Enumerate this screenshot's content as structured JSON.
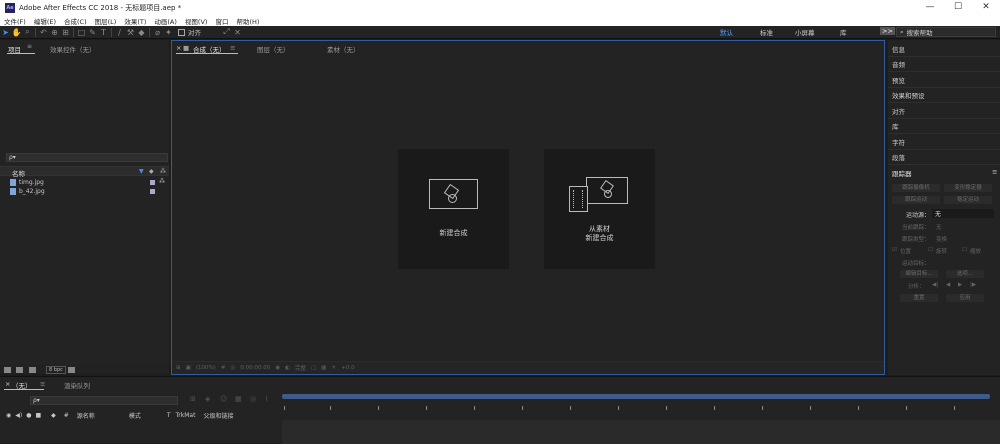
{
  "window": {
    "title": "Adobe After Effects CC 2018 - 无标题项目.aep *",
    "app_badge": "Ae",
    "minimize": "—",
    "maximize": "☐",
    "close": "✕"
  },
  "menu": [
    "文件(F)",
    "编辑(E)",
    "合成(C)",
    "图层(L)",
    "效果(T)",
    "动画(A)",
    "视图(V)",
    "窗口",
    "帮助(H)"
  ],
  "toolbar": {
    "align_label": "对齐",
    "workspaces": [
      "默认",
      "标准",
      "小屏幕",
      "库"
    ],
    "active_workspace": "默认",
    "overflow": ">>",
    "search_placeholder": "搜索帮助"
  },
  "project": {
    "tab_project": "项目",
    "tab_effects": "效果控件（无）",
    "search_placeholder": "ρ▾",
    "col_name": "名称",
    "files": [
      "timg.jpg",
      "b_42.jpg"
    ],
    "bpc": "8 bpc"
  },
  "comp": {
    "tab_comp": "合成（无）",
    "tab_layer": "图层（无）",
    "tab_footage": "素材（无）",
    "card1_label": "新建合成",
    "card2_label_line1": "从素材",
    "card2_label_line2": "新建合成",
    "footer": [
      "(100%)",
      "0:00:00:00",
      "完整",
      "+0.0"
    ]
  },
  "right": {
    "items": [
      "信息",
      "音频",
      "预览",
      "效果和预设",
      "对齐",
      "库",
      "字符",
      "段落"
    ],
    "tracker_title": "跟踪器",
    "tracker": {
      "track_camera": "跟踪摄像机",
      "warp_stabilizer": "变形稳定器",
      "track_motion": "跟踪运动",
      "stabilize_motion": "稳定运动",
      "motion_source_label": "运动源：",
      "motion_source_value": "无",
      "current_track_label": "当前跟踪：",
      "current_track_value": "无",
      "track_type_label": "跟踪类型：",
      "track_type_value": "变换",
      "position": "位置",
      "rotation": "旋转",
      "scale": "缩放",
      "motion_target": "运动目标：",
      "edit_target": "编辑目标...",
      "options": "选项...",
      "analyze": "分析：",
      "reset": "重置",
      "apply": "应用"
    }
  },
  "timeline": {
    "tab_none": "（无）",
    "tab_render": "渲染队列",
    "search_placeholder": "ρ▾",
    "cols": {
      "hash": "#",
      "source_name": "源名称",
      "mode": "模式",
      "t": "T",
      "trkmat": "TrkMat",
      "parent": "父级和链接"
    }
  }
}
